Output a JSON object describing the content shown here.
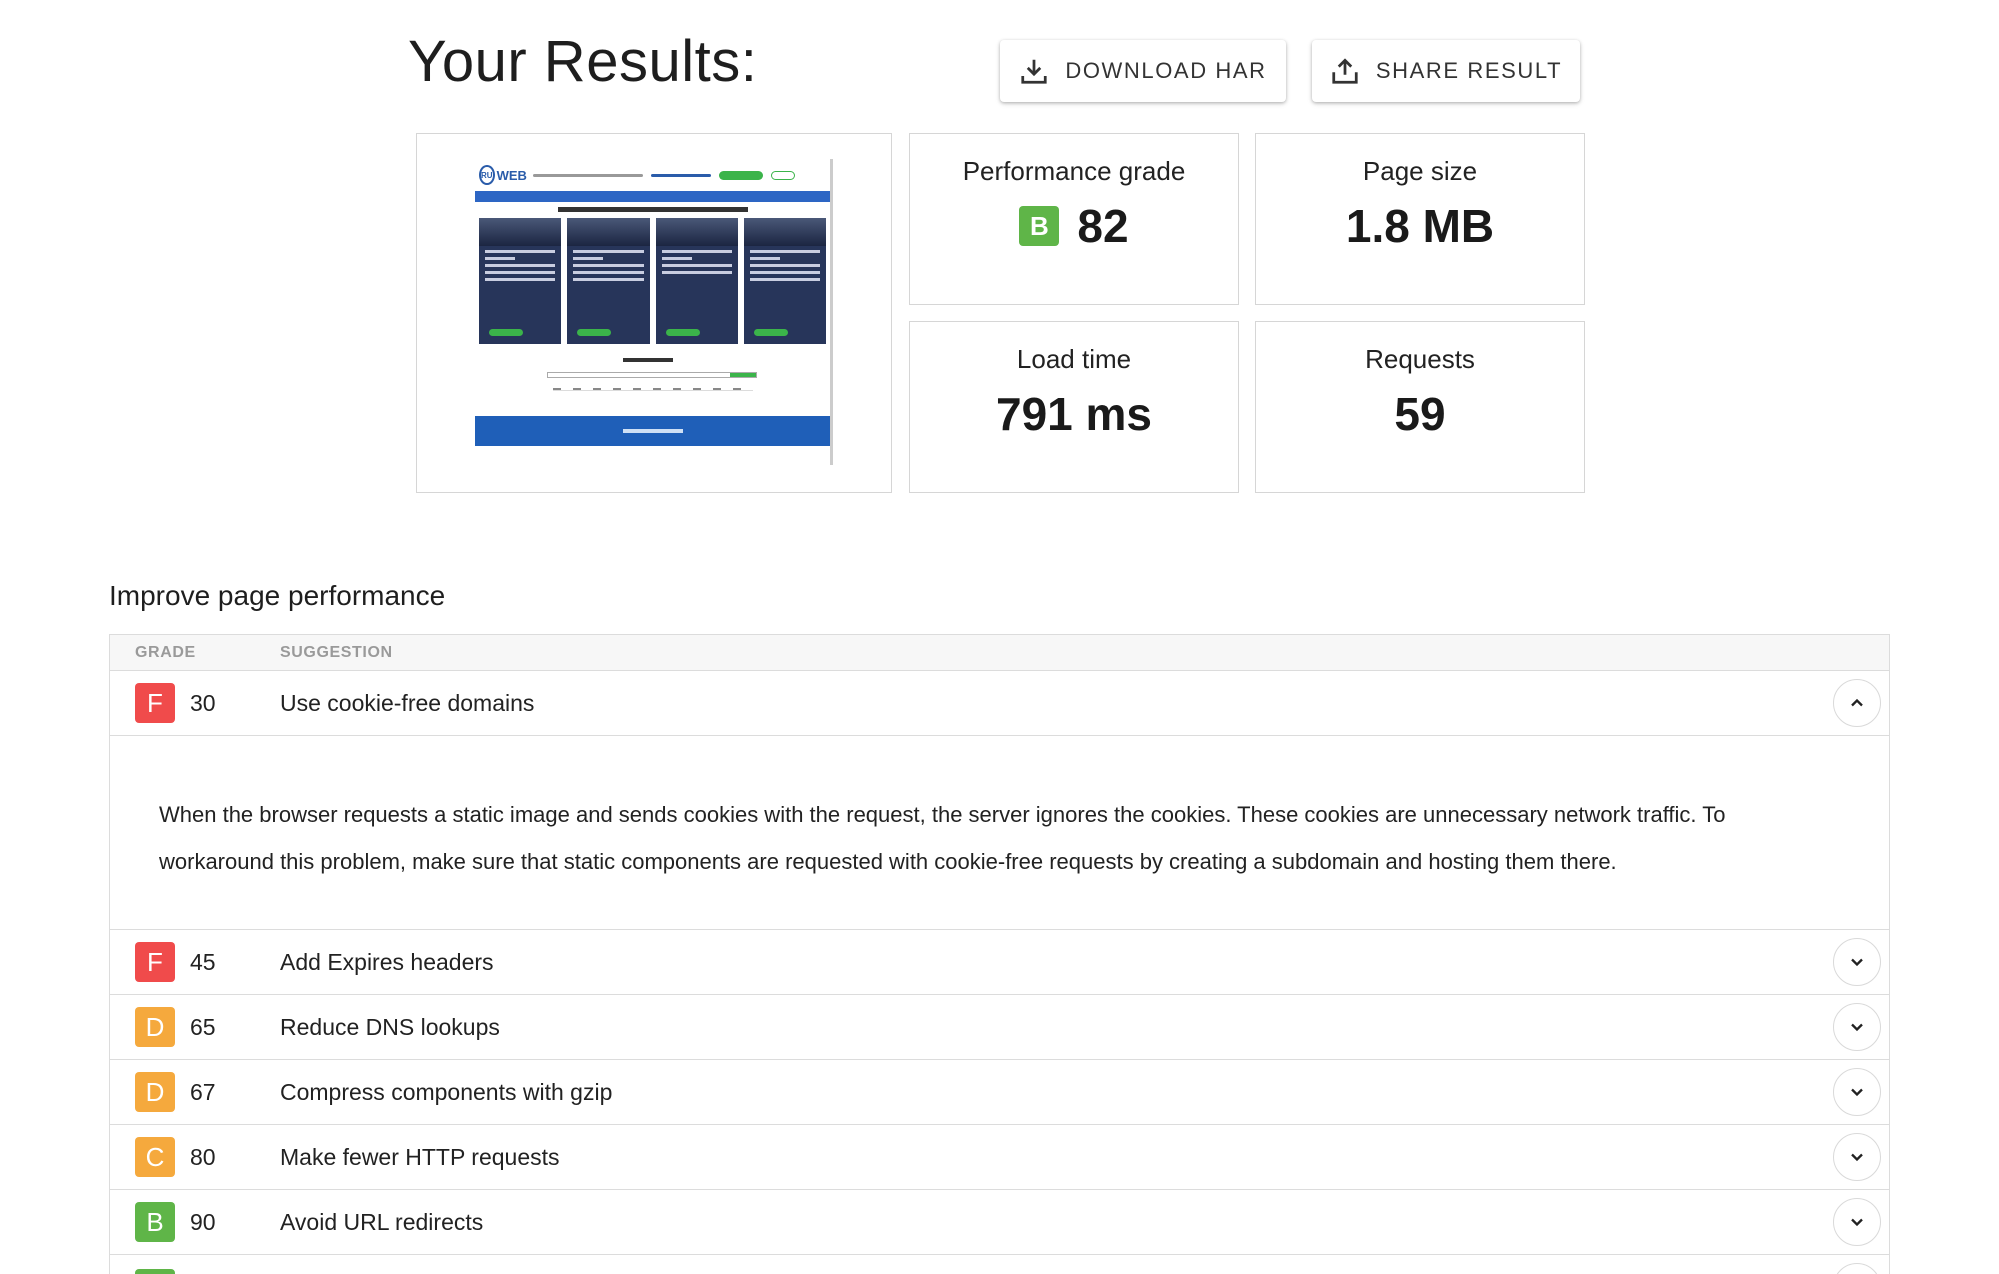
{
  "header": {
    "title": "Your Results:",
    "download_label": "DOWNLOAD HAR",
    "share_label": "SHARE RESULT"
  },
  "metrics": {
    "grade": {
      "label": "Performance grade",
      "letter": "B",
      "value": "82",
      "color": "#5fb548"
    },
    "size": {
      "label": "Page size",
      "value": "1.8 MB"
    },
    "load": {
      "label": "Load time",
      "value": "791 ms"
    },
    "requests": {
      "label": "Requests",
      "value": "59"
    }
  },
  "suggestions": {
    "title": "Improve page performance",
    "columns": {
      "grade": "GRADE",
      "suggestion": "SUGGESTION"
    },
    "expanded_detail": "When the browser requests a static image and sends cookies with the request, the server ignores the cookies. These cookies are unnecessary network traffic. To workaround this problem, make sure that static components are requested with cookie-free requests by creating a subdomain and hosting them there.",
    "rows": [
      {
        "letter": "F",
        "score": "30",
        "text": "Use cookie-free domains",
        "color": "#f04b4b",
        "expanded": true
      },
      {
        "letter": "F",
        "score": "45",
        "text": "Add Expires headers",
        "color": "#f04b4b",
        "expanded": false
      },
      {
        "letter": "D",
        "score": "65",
        "text": "Reduce DNS lookups",
        "color": "#f5a93d",
        "expanded": false
      },
      {
        "letter": "D",
        "score": "67",
        "text": "Compress components with gzip",
        "color": "#f5a93d",
        "expanded": false
      },
      {
        "letter": "C",
        "score": "80",
        "text": "Make fewer HTTP requests",
        "color": "#f5a93d",
        "expanded": false
      },
      {
        "letter": "B",
        "score": "90",
        "text": "Avoid URL redirects",
        "color": "#5fb548",
        "expanded": false
      }
    ],
    "partial_row_color": "#5fb548"
  },
  "icons": {
    "download": "download-icon",
    "share": "share-icon",
    "chevron_up": "chevron-up-icon",
    "chevron_down": "chevron-down-icon"
  }
}
